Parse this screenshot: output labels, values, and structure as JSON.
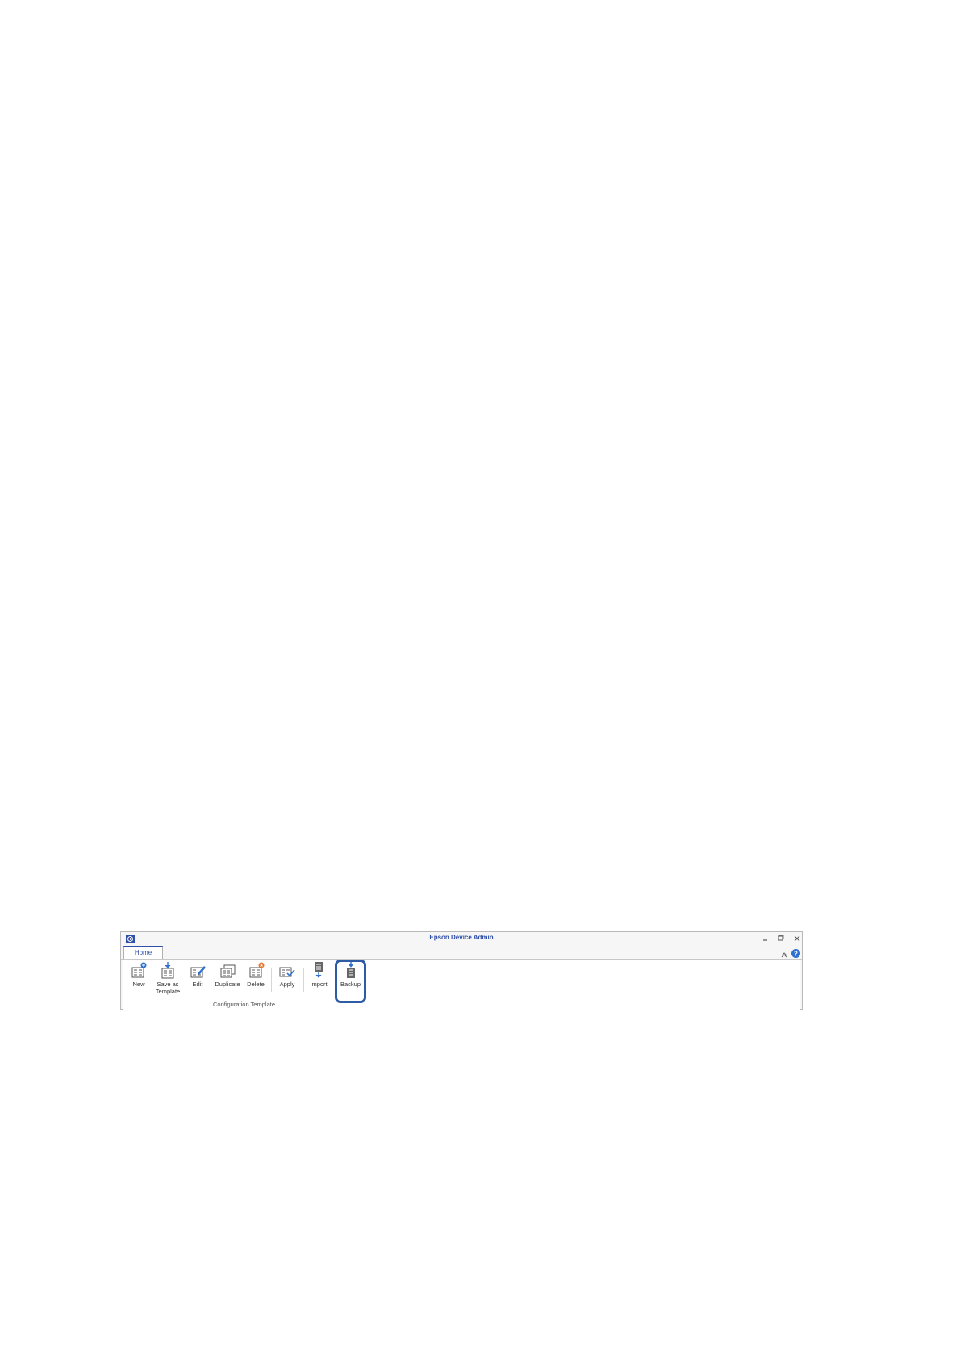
{
  "window": {
    "title": "Epson Device Admin"
  },
  "tabs": [
    {
      "label": "Home"
    }
  ],
  "ribbon": {
    "buttons": {
      "new": "New",
      "save_as_template_line1": "Save as",
      "save_as_template_line2": "Template",
      "edit": "Edit",
      "duplicate": "Duplicate",
      "delete": "Delete",
      "apply": "Apply",
      "import": "Import",
      "backup": "Backup"
    },
    "group_label": "Configuration Template",
    "highlighted_button": "backup"
  },
  "colors": {
    "accent": "#2f4fa8",
    "highlight": "#2d5ba6",
    "delete_badge": "#e8772e"
  }
}
